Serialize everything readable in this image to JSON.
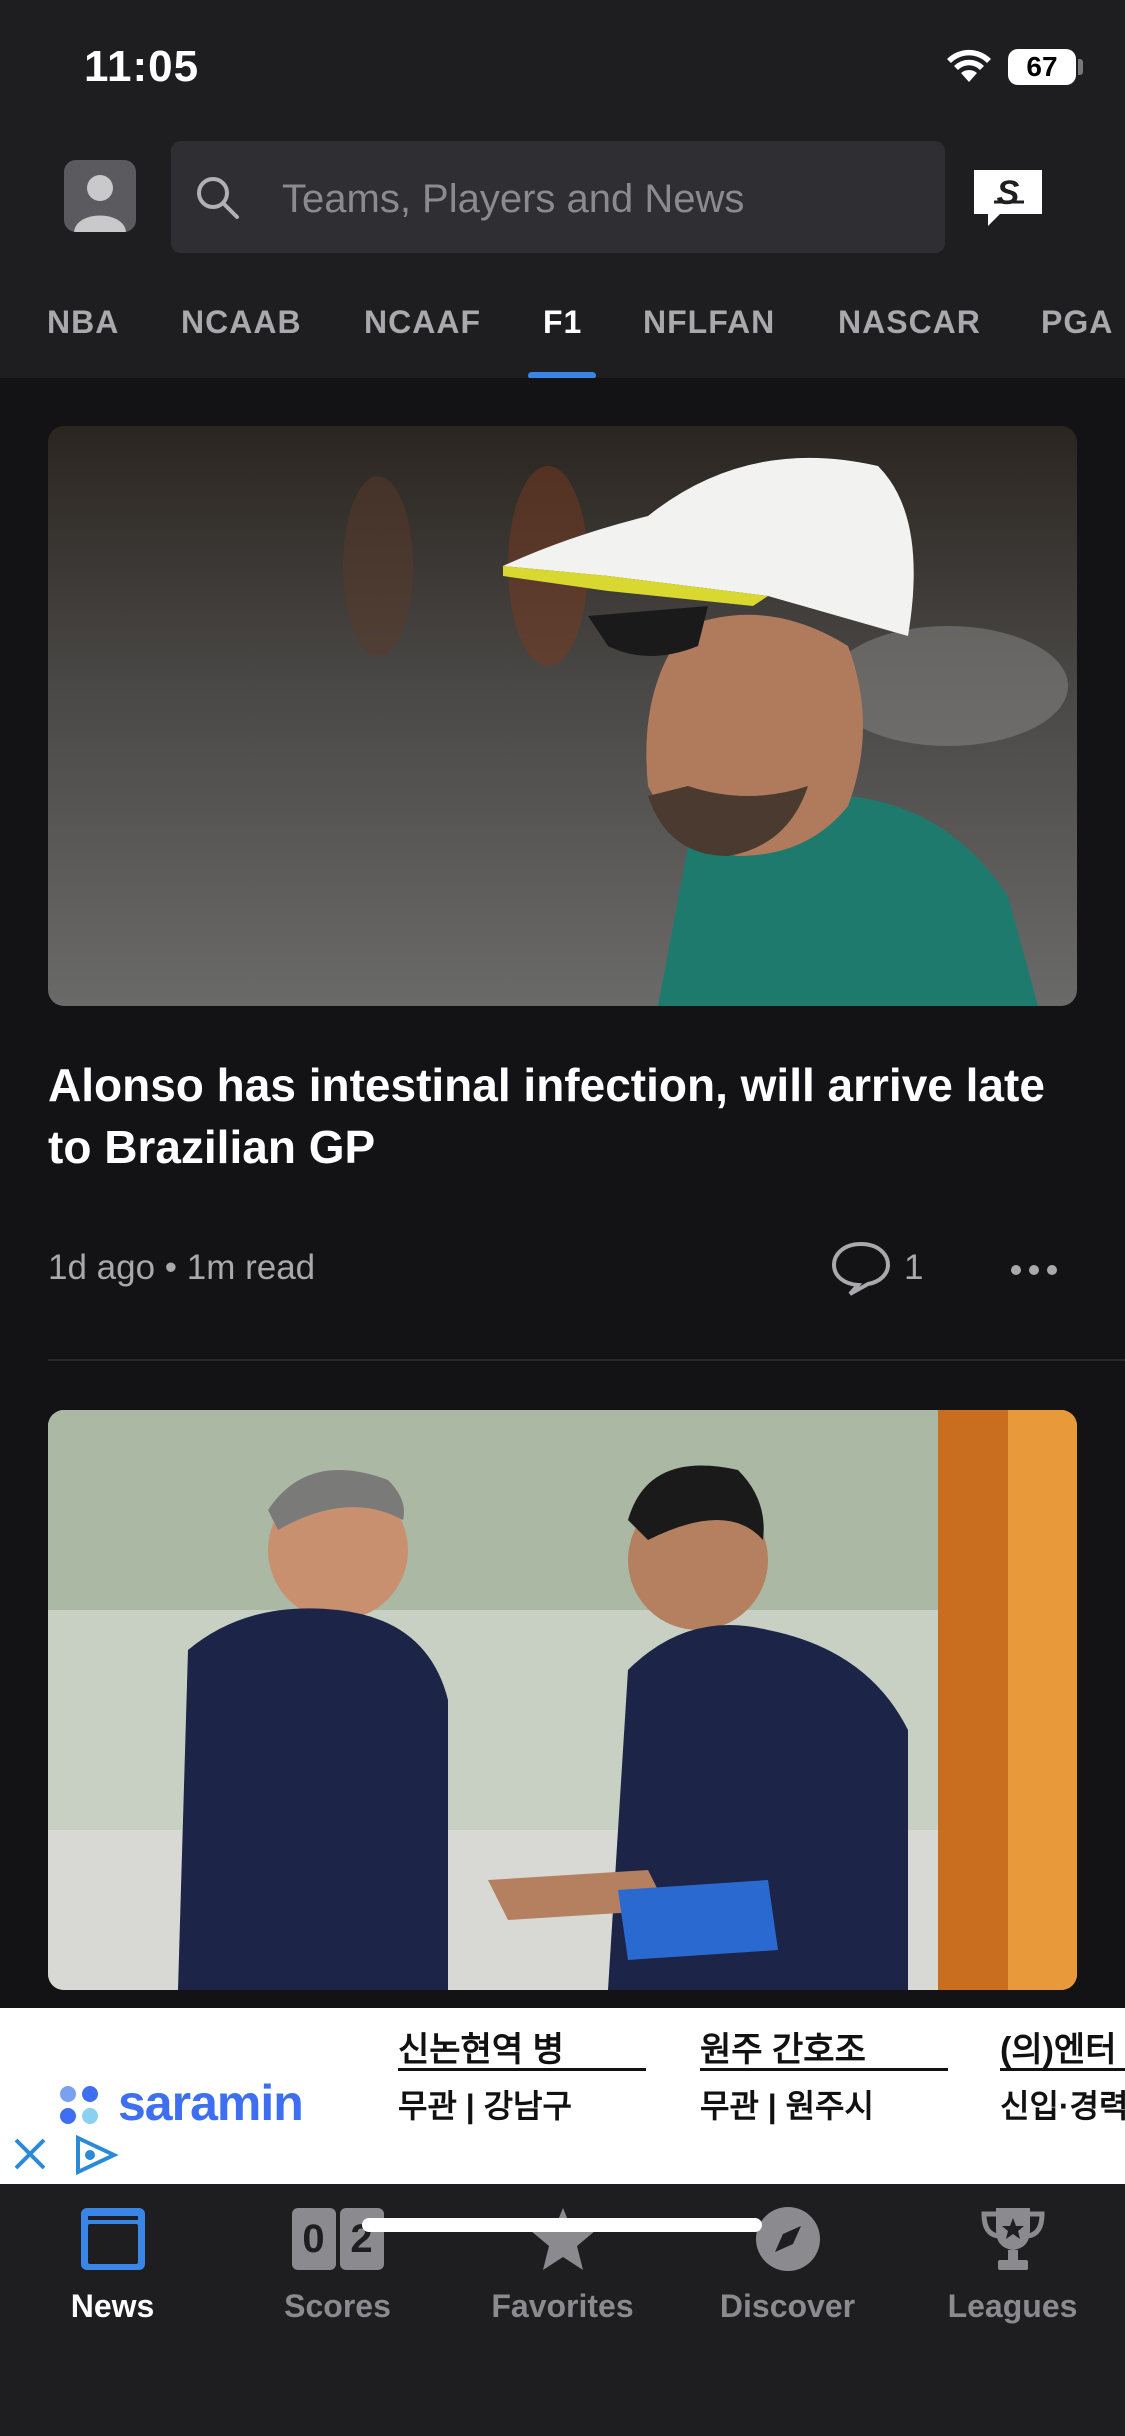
{
  "status_bar": {
    "time": "11:05",
    "battery": "67"
  },
  "header": {
    "search_placeholder": "Teams, Players and News",
    "tabs": [
      {
        "label": "NBA"
      },
      {
        "label": "NCAAB"
      },
      {
        "label": "NCAAF"
      },
      {
        "label": "F1"
      },
      {
        "label": "NFLFAN"
      },
      {
        "label": "NASCAR"
      },
      {
        "label": "PGA"
      }
    ],
    "active_tab": "F1"
  },
  "feed": {
    "articles": [
      {
        "headline": "Alonso has intestinal infection, will arrive late to Brazilian GP",
        "meta": "1d ago • 1m read",
        "comments": "1"
      }
    ]
  },
  "ad": {
    "brand": "saramin",
    "columns": [
      {
        "title": "신논현역 병",
        "subtitle": "무관 | 강남구"
      },
      {
        "title": "원주 간호조",
        "subtitle": "무관 | 원주시"
      },
      {
        "title": "(의)엔터",
        "subtitle": "신입·경력"
      }
    ]
  },
  "bottom_nav": {
    "items": [
      {
        "label": "News"
      },
      {
        "label": "Scores"
      },
      {
        "label": "Favorites"
      },
      {
        "label": "Discover"
      },
      {
        "label": "Leagues"
      }
    ],
    "scores_digits": [
      "0",
      "2"
    ]
  },
  "colors": {
    "accent": "#3a86e6",
    "background": "#131315",
    "header": "#1e1e21"
  }
}
